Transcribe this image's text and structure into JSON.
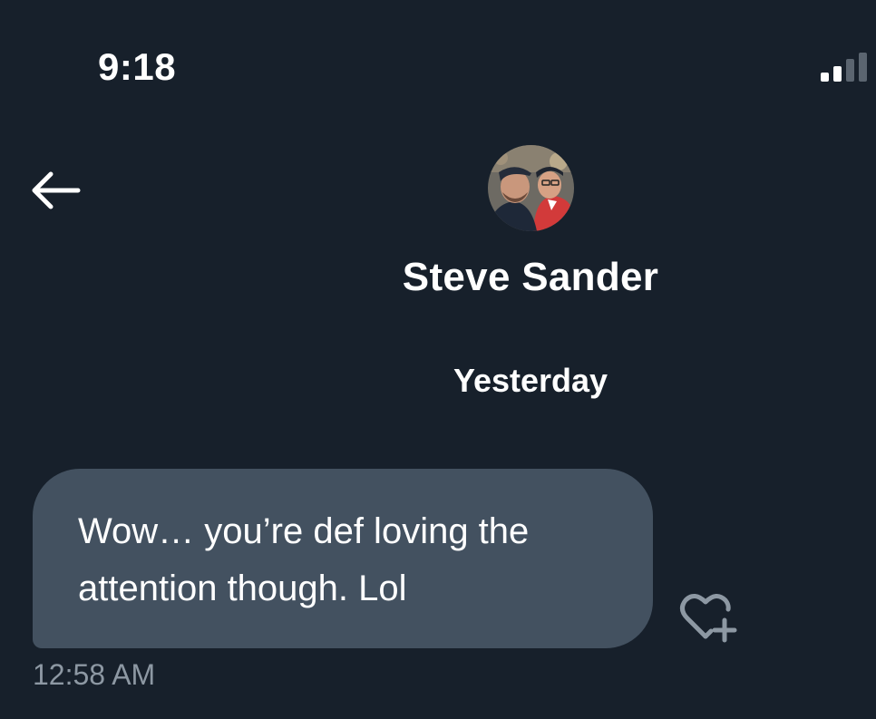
{
  "status_bar": {
    "time": "9:18",
    "signal_icon": "cellular-signal-icon"
  },
  "header": {
    "back_icon": "arrow-left-icon",
    "contact_name": "Steve Sander",
    "avatar_alt": "Steve Sander"
  },
  "conversation": {
    "date_separator": "Yesterday",
    "messages": [
      {
        "text": "Wow… you’re def loving the attention though. Lol",
        "timestamp": "12:58 AM",
        "reaction_icon": "heart-plus-icon"
      }
    ]
  },
  "colors": {
    "background": "#17202b",
    "bubble": "#435160",
    "timestamp": "#8d98a3",
    "text": "#ffffff"
  }
}
